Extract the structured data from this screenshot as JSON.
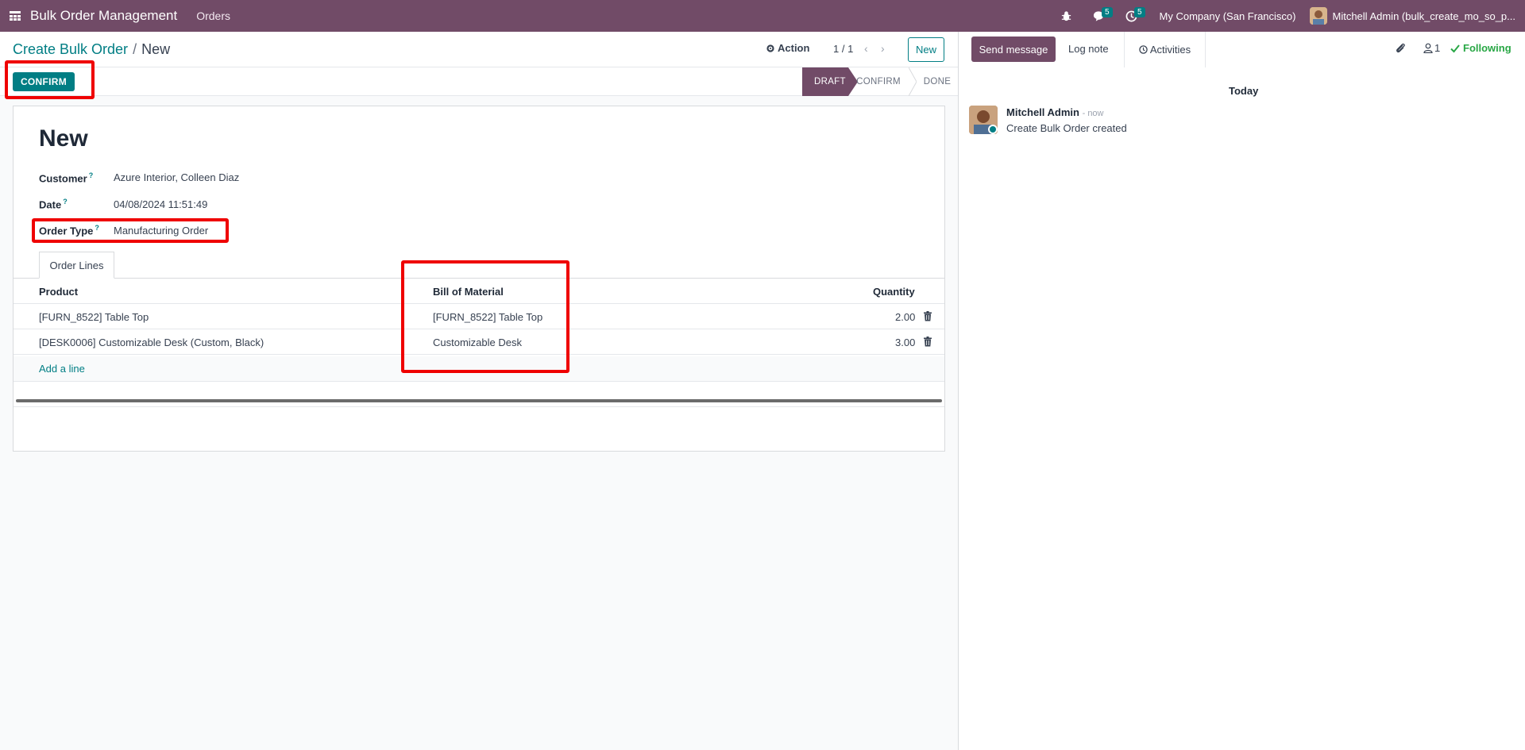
{
  "navbar": {
    "brand": "Bulk Order Management",
    "menu_orders": "Orders",
    "chat_badge": "5",
    "activity_badge": "5",
    "company": "My Company (San Francisco)",
    "user": "Mitchell Admin (bulk_create_mo_so_p..."
  },
  "control": {
    "breadcrumb_parent": "Create Bulk Order",
    "breadcrumb_sep": "/",
    "breadcrumb_current": "New",
    "action_label": "Action",
    "pager": "1 / 1",
    "new_label": "New"
  },
  "statusbar": {
    "confirm_label": "CONFIRM",
    "stages": [
      "DRAFT",
      "CONFIRM",
      "DONE"
    ],
    "active_stage": "DRAFT"
  },
  "form": {
    "title": "New",
    "fields": {
      "customer_label": "Customer",
      "customer_value": "Azure Interior, Colleen Diaz",
      "date_label": "Date",
      "date_value": "04/08/2024 11:51:49",
      "order_type_label": "Order Type",
      "order_type_value": "Manufacturing Order",
      "help_mark": "?"
    },
    "tab_label": "Order Lines",
    "table": {
      "headers": [
        "Product",
        "Bill of Material",
        "Quantity"
      ],
      "rows": [
        {
          "product": "[FURN_8522] Table Top",
          "bom": "[FURN_8522] Table Top",
          "qty": "2.00"
        },
        {
          "product": "[DESK0006] Customizable Desk (Custom, Black)",
          "bom": "Customizable Desk",
          "qty": "3.00"
        }
      ],
      "add_line": "Add a line"
    }
  },
  "chatter": {
    "send_message": "Send message",
    "log_note": "Log note",
    "activities": "Activities",
    "followers_count": "1",
    "following": "Following",
    "today": "Today",
    "message": {
      "author": "Mitchell Admin",
      "time": "- now",
      "body": "Create Bulk Order created"
    }
  },
  "colors": {
    "brand": "#714b67",
    "accent": "#017e84",
    "highlight": "#ef0000",
    "following": "#28a745"
  }
}
